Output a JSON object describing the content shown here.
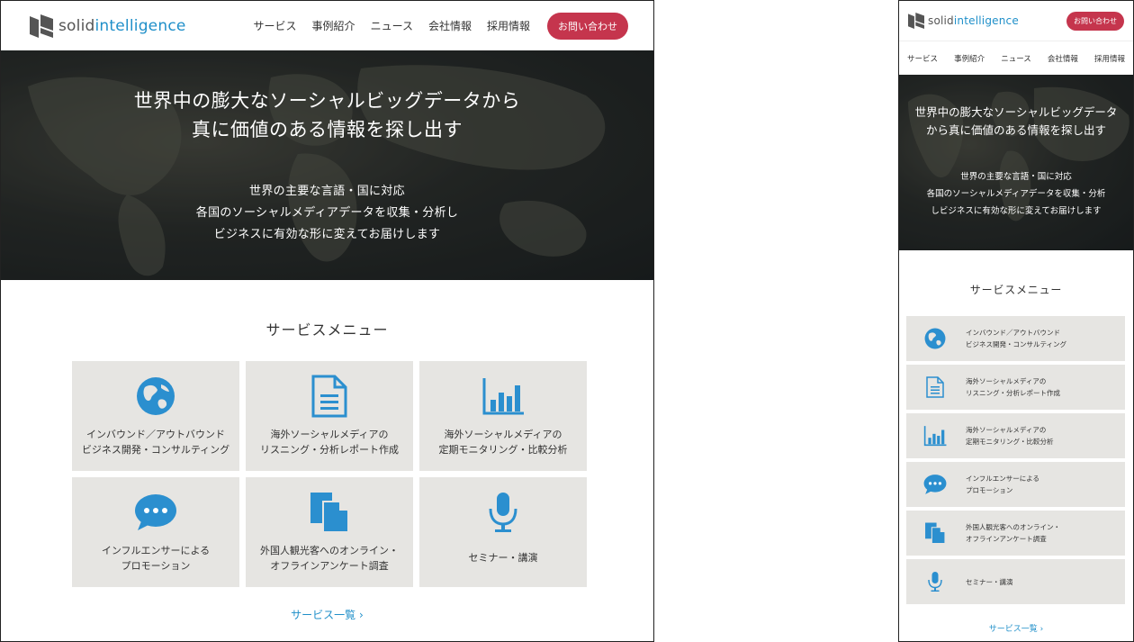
{
  "brand": {
    "name_prefix": "solid",
    "name_suffix": "intelligence",
    "accent_color": "#1f8fc9",
    "contact_color": "#c5354d"
  },
  "nav": {
    "items": [
      "サービス",
      "事例紹介",
      "ニュース",
      "会社情報",
      "採用情報"
    ],
    "contact_label": "お問い合わせ"
  },
  "hero": {
    "title_line1": "世界中の膨大なソーシャルビッグデータから",
    "title_line2": "真に価値のある情報を探し出す",
    "sub_line1": "世界の主要な言語・国に対応",
    "sub_line2": "各国のソーシャルメディアデータを収集・分析し",
    "sub_line3": "ビジネスに有効な形に変えてお届けします"
  },
  "mobile_hero": {
    "title_line1": "世界中の膨大なソーシャルビッグデータ",
    "title_line2": "から真に価値のある情報を探し出す",
    "sub_line1": "世界の主要な言語・国に対応",
    "sub_line2": "各国のソーシャルメディアデータを収集・分析",
    "sub_line3": "しビジネスに有効な形に変えてお届けします"
  },
  "services": {
    "title": "サービスメニュー",
    "more_label": "サービス一覧",
    "items": [
      {
        "icon": "globe-icon",
        "line1": "インバウンド／アウトバウンド",
        "line2": "ビジネス開発・コンサルティング"
      },
      {
        "icon": "document-icon",
        "line1": "海外ソーシャルメディアの",
        "line2": "リスニング・分析レポート作成"
      },
      {
        "icon": "bar-chart-icon",
        "line1": "海外ソーシャルメディアの",
        "line2": "定期モニタリング・比較分析"
      },
      {
        "icon": "speech-bubble-icon",
        "line1": "インフルエンサーによる",
        "line2": "プロモーション"
      },
      {
        "icon": "copy-documents-icon",
        "line1": "外国人観光客へのオンライン・",
        "line2": "オフラインアンケート調査"
      },
      {
        "icon": "microphone-icon",
        "line1": "セミナー・講演",
        "line2": ""
      }
    ]
  }
}
